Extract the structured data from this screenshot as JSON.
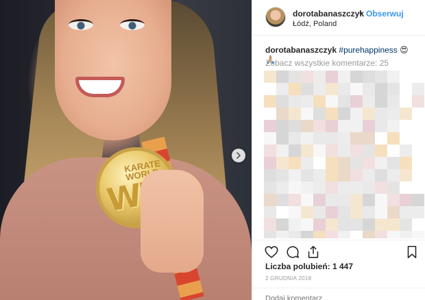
{
  "post": {
    "username": "dorotabanaszczyk",
    "follow_separator": "•",
    "follow_label": "Obserwuj",
    "location": "Łódź, Poland"
  },
  "caption": {
    "username": "dorotabanaszczyk",
    "hashtag": "#purehappiness",
    "emoji": "😍🙏🏼"
  },
  "comments": {
    "view_all_label": "Zobacz wszystkie komentarze: 25"
  },
  "engagement": {
    "likes_label": "Liczba polubień: 1 447",
    "date": "2 GRUDNIA 2018"
  },
  "composer": {
    "placeholder": "Dodaj komentarz..."
  },
  "medal_text": {
    "brand": "KARATE WORLD",
    "letters": "WK"
  },
  "icons": {
    "like": "heart-icon",
    "comment": "comment-bubble-icon",
    "share": "share-icon",
    "save": "bookmark-icon",
    "next": "chevron-right-icon"
  },
  "colors": {
    "accent": "#3897f0",
    "hashtag": "#003569",
    "muted": "#999999",
    "text": "#262626"
  }
}
